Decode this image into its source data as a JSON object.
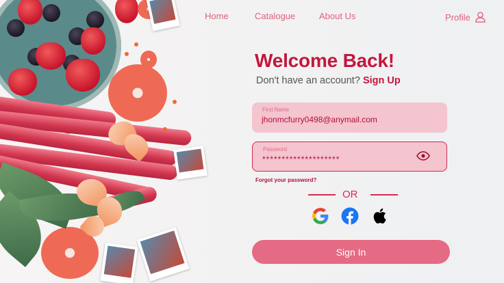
{
  "nav": {
    "home": "Home",
    "catalogue": "Catalogue",
    "about": "About Us",
    "profile": "Profile"
  },
  "login": {
    "title": "Welcome Back!",
    "no_account": "Don't have an account?",
    "sign_up": "Sign Up",
    "first_name_label": "First Name",
    "first_name_value": "jhonmcfurry0498@anymail.com",
    "password_label": "Password",
    "password_value": "********************",
    "forgot": "Forgot your password?",
    "or": "OR",
    "sign_in": "Sign In"
  },
  "social": [
    {
      "name": "google-icon"
    },
    {
      "name": "facebook-icon"
    },
    {
      "name": "apple-icon"
    }
  ],
  "colors": {
    "accent": "#c4163e",
    "nav": "#e0607e",
    "field_bg": "#f4c4cf",
    "button": "#e56a84"
  }
}
